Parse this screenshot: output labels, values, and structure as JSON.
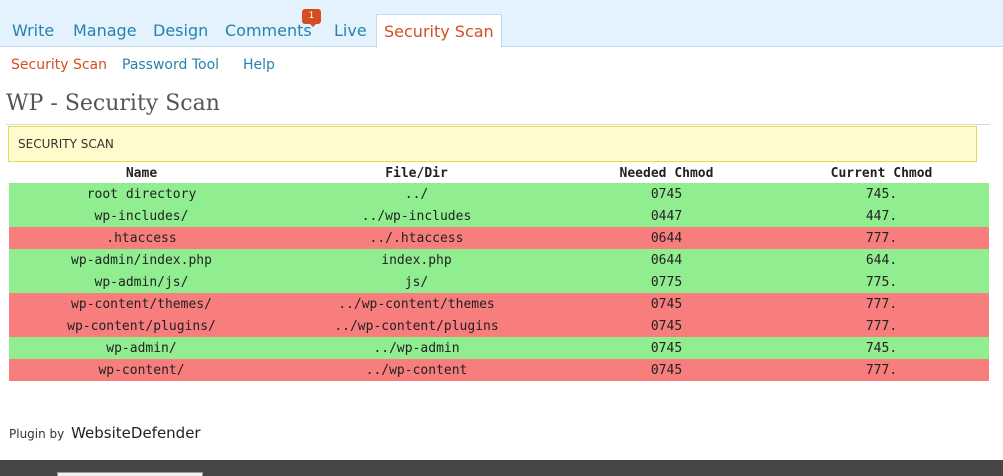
{
  "topnav": {
    "tabs": [
      {
        "label": "Write"
      },
      {
        "label": "Manage"
      },
      {
        "label": "Design"
      },
      {
        "label": "Comments"
      },
      {
        "label": "Live"
      },
      {
        "label": "Security Scan"
      }
    ],
    "comments_badge": "1",
    "active_tab": "Security Scan"
  },
  "subnav": {
    "items": [
      {
        "label": "Security Scan"
      },
      {
        "label": "Password Tool"
      },
      {
        "label": "Help"
      }
    ],
    "current": "Security Scan"
  },
  "page": {
    "title": "WP - Security Scan",
    "notice": "SECURITY SCAN"
  },
  "table": {
    "headers": [
      "Name",
      "File/Dir",
      "Needed Chmod",
      "Current Chmod"
    ],
    "rows": [
      {
        "name": "root directory",
        "path": "../",
        "needed": "0745",
        "current": "745.",
        "status": "ok"
      },
      {
        "name": "wp-includes/",
        "path": "../wp-includes",
        "needed": "0447",
        "current": "447.",
        "status": "ok"
      },
      {
        "name": ".htaccess",
        "path": "../.htaccess",
        "needed": "0644",
        "current": "777.",
        "status": "bad"
      },
      {
        "name": "wp-admin/index.php",
        "path": "index.php",
        "needed": "0644",
        "current": "644.",
        "status": "ok"
      },
      {
        "name": "wp-admin/js/",
        "path": "js/",
        "needed": "0775",
        "current": "775.",
        "status": "ok"
      },
      {
        "name": "wp-content/themes/",
        "path": "../wp-content/themes",
        "needed": "0745",
        "current": "777.",
        "status": "bad"
      },
      {
        "name": "wp-content/plugins/",
        "path": "../wp-content/plugins",
        "needed": "0745",
        "current": "777.",
        "status": "bad"
      },
      {
        "name": "wp-admin/",
        "path": "../wp-admin",
        "needed": "0745",
        "current": "745.",
        "status": "ok"
      },
      {
        "name": "wp-content/",
        "path": "../wp-content",
        "needed": "0745",
        "current": "777.",
        "status": "bad"
      }
    ]
  },
  "footer": {
    "prefix": "Plugin by",
    "link": "WebsiteDefender"
  },
  "colors": {
    "ok": "#90ee90",
    "bad": "#f87d7d",
    "link": "#2583ad",
    "active": "#d54e21"
  }
}
